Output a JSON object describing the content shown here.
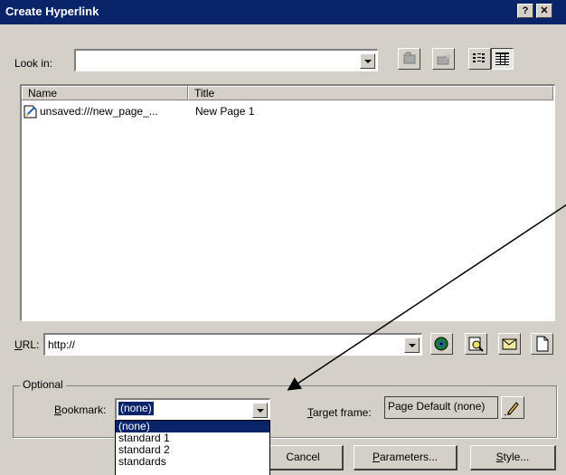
{
  "window": {
    "title": "Create Hyperlink",
    "help_label": "?",
    "close_label": "✕"
  },
  "look_in": {
    "label": "Look in:",
    "value": ""
  },
  "file_list": {
    "columns": [
      "Name",
      "Title"
    ],
    "rows": [
      {
        "name": "unsaved:///new_page_...",
        "title": "New Page 1"
      }
    ]
  },
  "url": {
    "label_u": "U",
    "label_rest": "RL:",
    "value": "http://"
  },
  "optional": {
    "group_label": "Optional",
    "bookmark_u": "B",
    "bookmark_rest": "ookmark:",
    "bookmark_value": "(none)",
    "bookmark_options": [
      "(none)",
      "standard 1",
      "standard 2",
      "standards"
    ],
    "target_u": "T",
    "target_rest": "arget frame:",
    "target_value": "Page Default (none)"
  },
  "buttons": {
    "cancel": "Cancel",
    "parameters_u": "P",
    "parameters_rest": "arameters...",
    "style_u": "S",
    "style_rest": "tyle..."
  },
  "icons": [
    "up-folder-icon",
    "new-folder-icon",
    "list-view-icon",
    "details-view-icon",
    "web-browse-icon",
    "file-browse-icon",
    "email-icon",
    "new-page-icon",
    "page-icon",
    "pencil-icon"
  ]
}
